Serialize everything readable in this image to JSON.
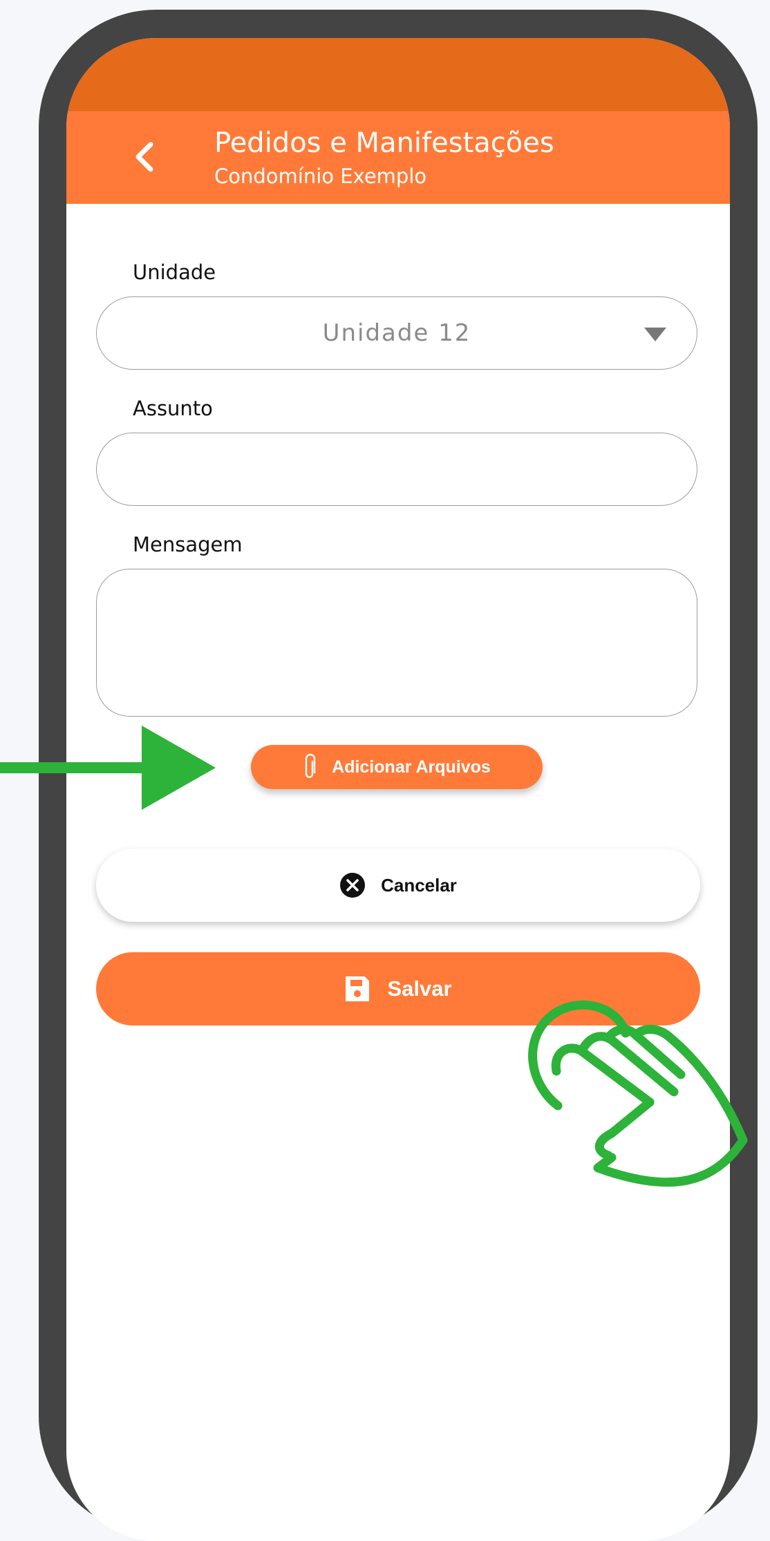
{
  "app_bar": {
    "title": "Pedidos e Manifestações",
    "subtitle": "Condomínio Exemplo",
    "back_icon": "chevron-left-icon"
  },
  "form": {
    "unit_label": "Unidade",
    "unit_value": "Unidade 12",
    "subject_label": "Assunto",
    "subject_value": "",
    "message_label": "Mensagem",
    "message_value": ""
  },
  "buttons": {
    "attach_label": "Adicionar Arquivos",
    "attach_icon": "paperclip-icon",
    "cancel_label": "Cancelar",
    "cancel_icon": "close-circle-icon",
    "save_label": "Salvar",
    "save_icon": "floppy-disk-icon"
  },
  "overlays": {
    "pointer_arrow": "arrow-right-icon",
    "tap_hand": "tap-hand-icon"
  },
  "colors": {
    "status_bar": "#e56a1a",
    "app_bar": "#ff7a38",
    "accent": "#ff7a38",
    "annotation_green": "#2db23a",
    "frame": "#444444"
  }
}
